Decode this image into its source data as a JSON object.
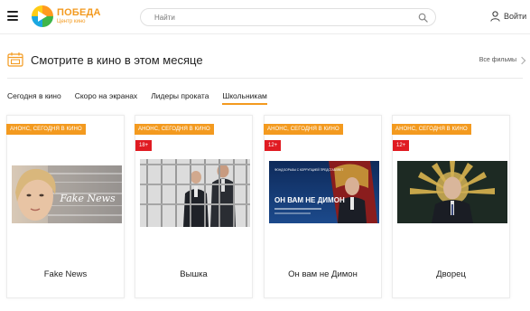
{
  "header": {
    "logo": {
      "name": "ПОБЕДА",
      "subtitle": "Центр кино"
    },
    "search": {
      "placeholder": "Найти",
      "value": ""
    },
    "login_label": "Войти"
  },
  "section": {
    "title": "Смотрите в кино в этом месяце",
    "all_films_label": "Все фильмы"
  },
  "tabs": [
    {
      "label": "Сегодня в кино",
      "active": false
    },
    {
      "label": "Скоро на экранах",
      "active": false
    },
    {
      "label": "Лидеры проката",
      "active": false
    },
    {
      "label": "Школьникам",
      "active": true
    }
  ],
  "films": [
    {
      "badge": "АНОНС, СЕГОДНЯ В КИНО",
      "age": "",
      "title": "Fake News",
      "poster_text": "Fake News"
    },
    {
      "badge": "АНОНС, СЕГОДНЯ В КИНО",
      "age": "18+",
      "title": "Вышка",
      "poster_text": ""
    },
    {
      "badge": "АНОНС, СЕГОДНЯ В КИНО",
      "age": "12+",
      "title": "Он вам не Димон",
      "poster_text": "ОН ВАМ НЕ ДИМОН",
      "poster_caption": "ФОНД БОРЬБЫ С КОРРУПЦИЕЙ ПРЕДСТАВЛЯЕТ"
    },
    {
      "badge": "АНОНС, СЕГОДНЯ В КИНО",
      "age": "12+",
      "title": "Дворец",
      "poster_text": ""
    }
  ],
  "colors": {
    "accent": "#f39a1f",
    "age_badge": "#e01b22",
    "text": "#222222",
    "border": "#ececec"
  }
}
